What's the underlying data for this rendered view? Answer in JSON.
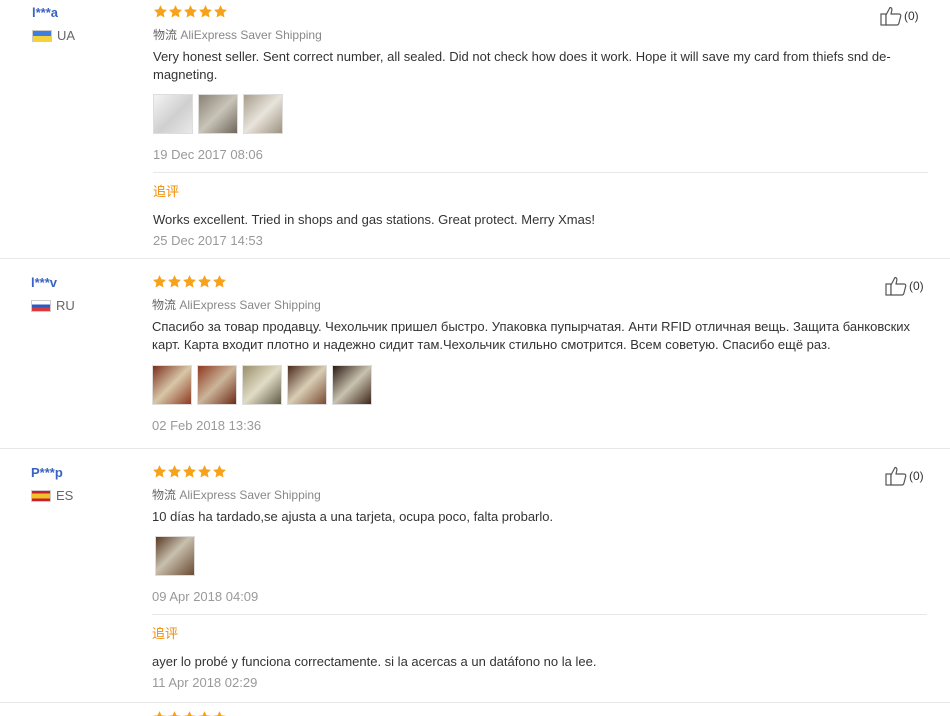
{
  "colors": {
    "star": "#f7a21b",
    "username": "#3a62c2",
    "followup": "#f38a00",
    "date": "#999999"
  },
  "reviews": [
    {
      "username": "l***a",
      "country": "UA",
      "flag": "flag-ua",
      "rating": 5,
      "shipping_cn": "物流",
      "shipping": "AliExpress Saver Shipping",
      "text": "Very honest seller. Sent correct number, all sealed. Did not check how does it work. Hope it will save my card from thiefs snd de-magneting.",
      "photo_count": 3,
      "date": "19 Dec 2017 08:06",
      "helpful": "(0)",
      "followup_label": "追评",
      "followup_text": "Works excellent. Tried in shops and gas stations. Great protect. Merry Xmas!",
      "followup_date": "25 Dec 2017 14:53"
    },
    {
      "username": "l***v",
      "country": "RU",
      "flag": "flag-ru",
      "rating": 5,
      "shipping_cn": "物流",
      "shipping": "AliExpress Saver Shipping",
      "text": "Спасибо за товар продавцу. Чехольчик пришел быстро. Упаковка пупырчатая. Анти RFID отличная вещь. Защита банковских карт. Карта входит плотно и надежно сидит там.Чехольчик стильно смотрится. Всем советую. Спасибо ещё раз.",
      "photo_count": 5,
      "date": "02 Feb 2018 13:36",
      "helpful": "(0)"
    },
    {
      "username": "P***p",
      "country": "ES",
      "flag": "flag-es",
      "rating": 5,
      "shipping_cn": "物流",
      "shipping": "AliExpress Saver Shipping",
      "text": "10 días ha tardado,se ajusta a una tarjeta, ocupa poco, falta probarlo.",
      "photo_count": 1,
      "date": "09 Apr 2018 04:09",
      "helpful": "(0)",
      "followup_label": "追评",
      "followup_text": "ayer lo probé y funciona correctamente. si la acercas a un datáfono no la lee.",
      "followup_date": "11 Apr 2018 02:29"
    }
  ]
}
